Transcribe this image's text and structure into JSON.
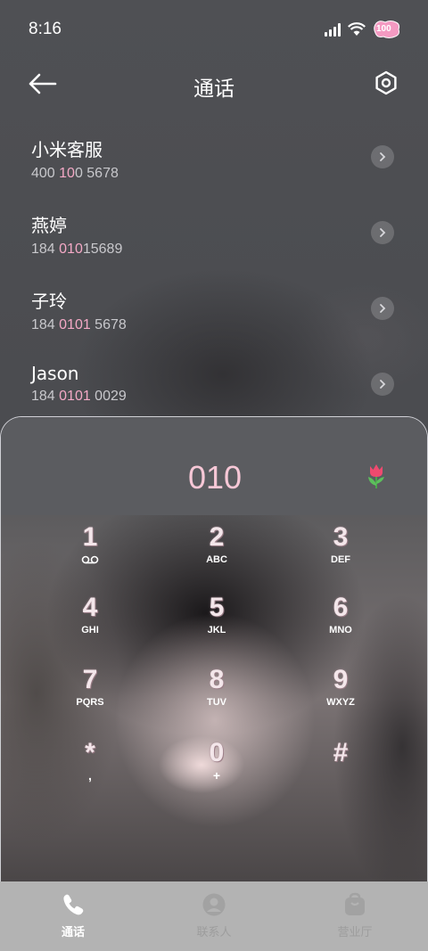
{
  "status_bar": {
    "time": "8:16",
    "battery": "100"
  },
  "header": {
    "title": "通话"
  },
  "contacts": [
    {
      "name": "小米客服",
      "number_pre": "400 ",
      "number_match": "10",
      "number_post": "0 5678"
    },
    {
      "name": "燕婷",
      "number_pre": "184 ",
      "number_match": "010",
      "number_post": "15689"
    },
    {
      "name": "子玲",
      "number_pre": "184 ",
      "number_match": "0101",
      "number_post": " 5678"
    },
    {
      "name": "Jason",
      "number_pre": "184 ",
      "number_match": "0101",
      "number_post": " 0029"
    }
  ],
  "dialer": {
    "display": "010",
    "keys": [
      {
        "digit": "1",
        "letters": ""
      },
      {
        "digit": "2",
        "letters": "ABC"
      },
      {
        "digit": "3",
        "letters": "DEF"
      },
      {
        "digit": "4",
        "letters": "GHI"
      },
      {
        "digit": "5",
        "letters": "JKL"
      },
      {
        "digit": "6",
        "letters": "MNO"
      },
      {
        "digit": "7",
        "letters": "PQRS"
      },
      {
        "digit": "8",
        "letters": "TUV"
      },
      {
        "digit": "9",
        "letters": "WXYZ"
      },
      {
        "digit": "*",
        "letters": ","
      },
      {
        "digit": "0",
        "letters": "+"
      },
      {
        "digit": "#",
        "letters": ""
      }
    ]
  },
  "tabs": [
    {
      "label": "通话",
      "icon": "phone-icon",
      "active": true
    },
    {
      "label": "联系人",
      "icon": "person-icon",
      "active": false
    },
    {
      "label": "营业厅",
      "icon": "bag-icon",
      "active": false
    }
  ],
  "colors": {
    "accent_pink": "#f6c7d6",
    "match_pink": "#f4a9c6",
    "tab_bar": "#b3b3b3"
  }
}
